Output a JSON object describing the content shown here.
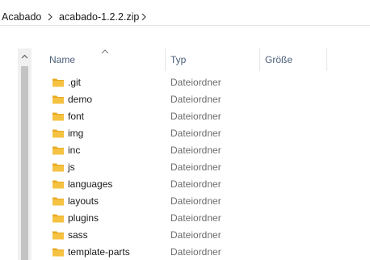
{
  "breadcrumb": {
    "items": [
      {
        "label": "Acabado"
      },
      {
        "label": "acabado-1.2.2.zip"
      }
    ]
  },
  "columns": {
    "name": "Name",
    "type": "Typ",
    "size": "Größe"
  },
  "files": [
    {
      "name": ".git",
      "type": "Dateiordner",
      "icon": "folder-icon"
    },
    {
      "name": "demo",
      "type": "Dateiordner",
      "icon": "folder-icon"
    },
    {
      "name": "font",
      "type": "Dateiordner",
      "icon": "folder-icon"
    },
    {
      "name": "img",
      "type": "Dateiordner",
      "icon": "folder-icon"
    },
    {
      "name": "inc",
      "type": "Dateiordner",
      "icon": "folder-icon"
    },
    {
      "name": "js",
      "type": "Dateiordner",
      "icon": "folder-icon"
    },
    {
      "name": "languages",
      "type": "Dateiordner",
      "icon": "folder-icon"
    },
    {
      "name": "layouts",
      "type": "Dateiordner",
      "icon": "folder-icon"
    },
    {
      "name": "plugins",
      "type": "Dateiordner",
      "icon": "folder-icon"
    },
    {
      "name": "sass",
      "type": "Dateiordner",
      "icon": "folder-icon"
    },
    {
      "name": "template-parts",
      "type": "Dateiordner",
      "icon": "folder-icon"
    }
  ],
  "colors": {
    "folder_body": "#f5c242",
    "folder_tab": "#e8a921",
    "header_text": "#4c607a",
    "type_text": "#6d6d6d"
  }
}
